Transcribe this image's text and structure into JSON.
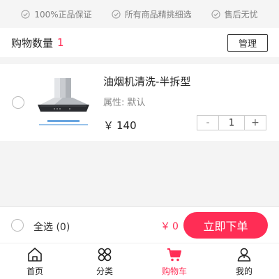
{
  "guarantees": [
    {
      "label": "100%正品保证",
      "icon": "check-circle-icon"
    },
    {
      "label": "所有商品精挑细选",
      "icon": "check-circle-icon"
    },
    {
      "label": "售后无忧",
      "icon": "check-circle-icon"
    }
  ],
  "header": {
    "count_label": "购物数量",
    "count_value": "1",
    "manage_label": "管理"
  },
  "cart": {
    "items": [
      {
        "title": "油烟机清洗-半拆型",
        "attr_label": "属性:",
        "attr_value": "默认",
        "price_currency": "￥",
        "price": "140",
        "quantity": "1",
        "minus_label": "-",
        "plus_label": "+",
        "image_icon": "range-hood-image"
      }
    ]
  },
  "checkout": {
    "select_all_label": "全选 (0)",
    "total_currency": "￥",
    "total_value": "0",
    "order_label": "立即下单"
  },
  "nav": {
    "items": [
      {
        "label": "首页",
        "icon": "home-icon",
        "active": false
      },
      {
        "label": "分类",
        "icon": "category-icon",
        "active": false
      },
      {
        "label": "购物车",
        "icon": "cart-icon",
        "active": true
      },
      {
        "label": "我的",
        "icon": "user-icon",
        "active": false
      }
    ]
  },
  "colors": {
    "accent": "#ff2d55",
    "background": "#f4f4f4",
    "muted_text": "#888888"
  }
}
